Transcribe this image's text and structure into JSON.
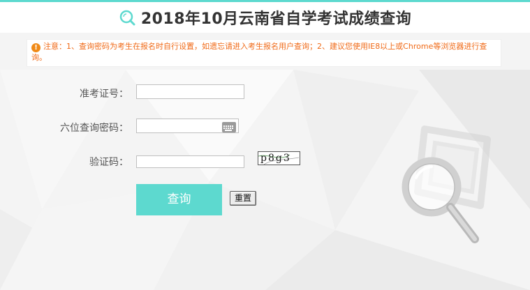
{
  "header": {
    "title": "2018年10月云南省自学考试成绩查询"
  },
  "notice": {
    "text": "注意：1、查询密码为考生在报名时自行设置，如遗忘请进入考生报名用户查询；2、建议您使用IE8以上或Chrome等浏览器进行查询。"
  },
  "form": {
    "exam_id_label": "准考证号：",
    "exam_id_value": "",
    "password_label": "六位查询密码：",
    "password_value": "",
    "captcha_label": "验证码：",
    "captcha_value": "",
    "captcha_text": "p8g3"
  },
  "buttons": {
    "query_label": "查询",
    "reset_label": "重置"
  },
  "colors": {
    "accent": "#5dd9cf",
    "notice_text": "#f06a17",
    "warning_icon": "#f08a17"
  },
  "icons": {
    "title": "search-icon",
    "notice": "warning-icon",
    "password_field": "keyboard-icon",
    "decoration": "magnifier-icon"
  }
}
